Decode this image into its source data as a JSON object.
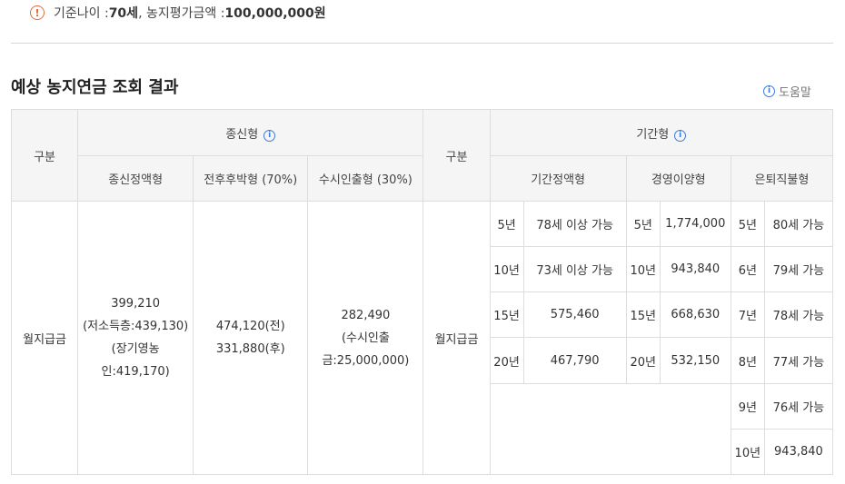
{
  "notice": {
    "prefix": "기준나이 : ",
    "age": "70세",
    "sep": ", 농지평가금액 : ",
    "amount": "100,000,000원"
  },
  "section": {
    "title": "예상 농지연금 조회 결과",
    "help_label": "도움말"
  },
  "table": {
    "gubun": "구분",
    "lifetime": {
      "title": "종신형",
      "cols": [
        "종신정액형",
        "전후후박형 (70%)",
        "수시인출형 (30%)"
      ]
    },
    "term": {
      "title": "기간형",
      "cols": [
        "기간정액형",
        "경영이양형",
        "은퇴직불형"
      ]
    },
    "row_label": "월지급금",
    "lifetime_values": {
      "fixed": [
        "399,210",
        "(저소득층:439,130)",
        "(장기영농인:419,170)"
      ],
      "front_loaded": [
        "474,120(전)",
        "331,880(후)"
      ],
      "withdrawal": [
        "282,490",
        "(수시인출",
        "금:25,000,000)"
      ]
    },
    "rows": [
      {
        "fixed_year": "5년",
        "fixed_val": "78세 이상 가능",
        "transfer_year": "5년",
        "transfer_val": "1,774,000",
        "retire_year": "5년",
        "retire_val": "80세 가능"
      },
      {
        "fixed_year": "10년",
        "fixed_val": "73세 이상 가능",
        "transfer_year": "10년",
        "transfer_val": "943,840",
        "retire_year": "6년",
        "retire_val": "79세 가능"
      },
      {
        "fixed_year": "15년",
        "fixed_val": "575,460",
        "transfer_year": "15년",
        "transfer_val": "668,630",
        "retire_year": "7년",
        "retire_val": "78세 가능"
      },
      {
        "fixed_year": "20년",
        "fixed_val": "467,790",
        "transfer_year": "20년",
        "transfer_val": "532,150",
        "retire_year": "8년",
        "retire_val": "77세 가능"
      },
      {
        "retire_year": "9년",
        "retire_val": "76세 가능"
      },
      {
        "retire_year": "10년",
        "retire_val": "943,840"
      }
    ]
  },
  "icons": {
    "notice": "exclamation-circle-icon",
    "info": "info-circle-icon"
  },
  "colors": {
    "notice_accent": "#e26a3c",
    "info_accent": "#3b7bd9",
    "header_bg": "#f5f5f5",
    "border": "#dddddd"
  }
}
